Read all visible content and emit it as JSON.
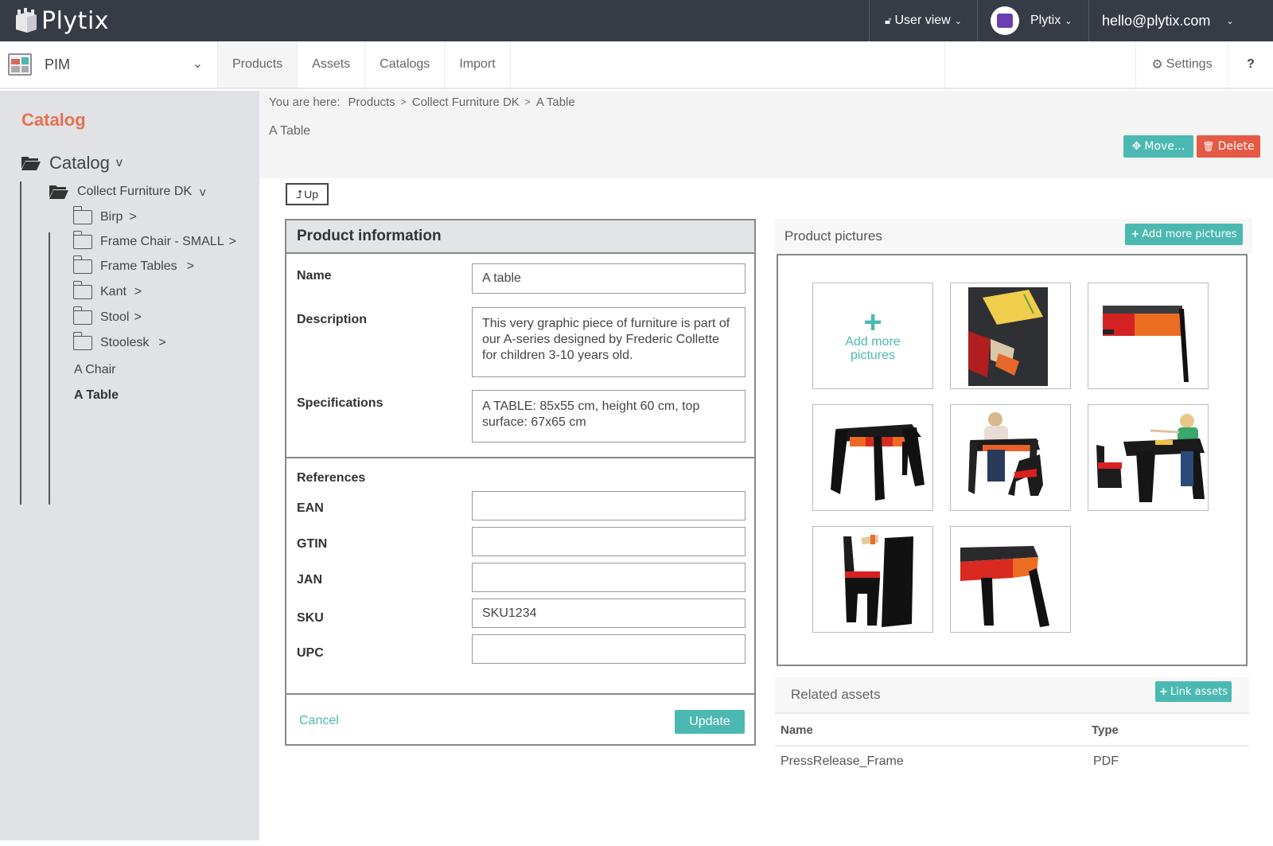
{
  "topbar": {
    "brand": "Plytix",
    "user_view_label": "User view",
    "account_label": "Plytix",
    "email": "hello@plytix.com"
  },
  "navbar": {
    "module": "PIM",
    "tabs": [
      {
        "label": "Products",
        "active": true
      },
      {
        "label": "Assets",
        "active": false
      },
      {
        "label": "Catalogs",
        "active": false
      },
      {
        "label": "Import",
        "active": false
      }
    ],
    "settings_label": "Settings",
    "help_label": "?"
  },
  "sidebar": {
    "title": "Catalog",
    "root": {
      "label": "Catalog",
      "toggle": "v"
    },
    "group": {
      "label": "Collect Furniture DK",
      "toggle": "v"
    },
    "folders": [
      {
        "label": "Birp",
        "arrow": ">"
      },
      {
        "label": "Frame Chair - SMALL",
        "arrow": ">"
      },
      {
        "label": "Frame Tables",
        "arrow": ">"
      },
      {
        "label": "Kant",
        "arrow": ">"
      },
      {
        "label": "Stool",
        "arrow": ">"
      },
      {
        "label": "Stoolesk",
        "arrow": ">"
      }
    ],
    "products": [
      {
        "label": "A Chair",
        "selected": false
      },
      {
        "label": "A Table",
        "selected": true
      }
    ]
  },
  "breadcrumb": {
    "prefix": "You are here:",
    "items": [
      "Products",
      "Collect Furniture DK",
      "A Table"
    ],
    "separator": ">"
  },
  "page": {
    "title": "A Table",
    "move_label": "Move...",
    "delete_label": "Delete",
    "up_label": "Up"
  },
  "product_info": {
    "header": "Product information",
    "fields": {
      "name": {
        "label": "Name",
        "value": "A table"
      },
      "description": {
        "label": "Description",
        "value": "This very graphic piece of furniture is part of our A-series designed by Frederic Collette for children 3-10 years old."
      },
      "specifications": {
        "label": "Specifications",
        "value": "A TABLE: 85x55 cm, height 60 cm, top surface: 67x65 cm"
      }
    },
    "references_label": "References",
    "references": [
      {
        "label": "EAN",
        "value": ""
      },
      {
        "label": "GTIN",
        "value": ""
      },
      {
        "label": "JAN",
        "value": ""
      },
      {
        "label": "SKU",
        "value": "SKU1234"
      },
      {
        "label": "UPC",
        "value": ""
      }
    ],
    "cancel_label": "Cancel",
    "update_label": "Update"
  },
  "pictures": {
    "title": "Product pictures",
    "add_button_label": "Add more pictures",
    "add_tile_label": "Add more pictures",
    "images": [
      "table-top-with-drawers",
      "table-drawers-side",
      "table-front",
      "table-with-child-and-chair",
      "table-with-child-pointing",
      "chair-and-table-side",
      "table-drawers-closeup"
    ]
  },
  "related_assets": {
    "title": "Related assets",
    "link_button_label": "Link assets",
    "columns": [
      "Name",
      "Type"
    ],
    "rows": [
      {
        "name": "PressRelease_Frame",
        "type": "PDF"
      }
    ]
  },
  "colors": {
    "topbar": "#363b45",
    "accent_teal": "#4bb9b1",
    "danger_red": "#e55a45",
    "sidebar_title": "#e8704f",
    "sidebar_bg": "#e1e2e5"
  }
}
